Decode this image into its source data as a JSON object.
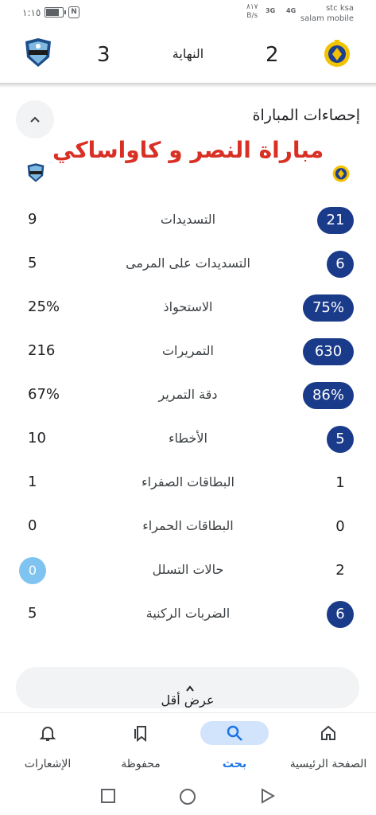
{
  "status_bar": {
    "time": "١:١٥",
    "speed_value": "٨١٧",
    "speed_unit": "B/s",
    "net1": "3G",
    "net2": "4G",
    "carrier1": "stc ksa",
    "carrier2": "salam mobile"
  },
  "match": {
    "status": "النهاية",
    "home_score": "2",
    "away_score": "3"
  },
  "stats_section": {
    "title": "إحصاءات المباراة",
    "overlay_caption": "مباراة النصر و كاواساكي",
    "show_less_label": "عرض أقل",
    "rows": [
      {
        "label": "التسديدات",
        "home": "21",
        "away": "9"
      },
      {
        "label": "التسديدات على المرمى",
        "home": "6",
        "away": "5"
      },
      {
        "label": "الاستحواذ",
        "home": "75%",
        "away": "25%"
      },
      {
        "label": "التمريرات",
        "home": "630",
        "away": "216"
      },
      {
        "label": "دقة التمرير",
        "home": "86%",
        "away": "67%"
      },
      {
        "label": "الأخطاء",
        "home": "5",
        "away": "10"
      },
      {
        "label": "البطاقات الصفراء",
        "home": "1",
        "away": "1"
      },
      {
        "label": "البطاقات الحمراء",
        "home": "0",
        "away": "0"
      },
      {
        "label": "حالات التسلل",
        "home": "2",
        "away": "0"
      },
      {
        "label": "الضربات الركنية",
        "home": "6",
        "away": "5"
      }
    ]
  },
  "bottom_nav": {
    "home": "الصفحة الرئيسية",
    "search": "بحث",
    "saved": "محفوظة",
    "notifications": "الإشعارات"
  },
  "colors": {
    "home_pill": "#1a3a8a",
    "away_pill": "#7fc4f0",
    "accent": "#1a73e8",
    "overlay_text": "#d93025"
  }
}
